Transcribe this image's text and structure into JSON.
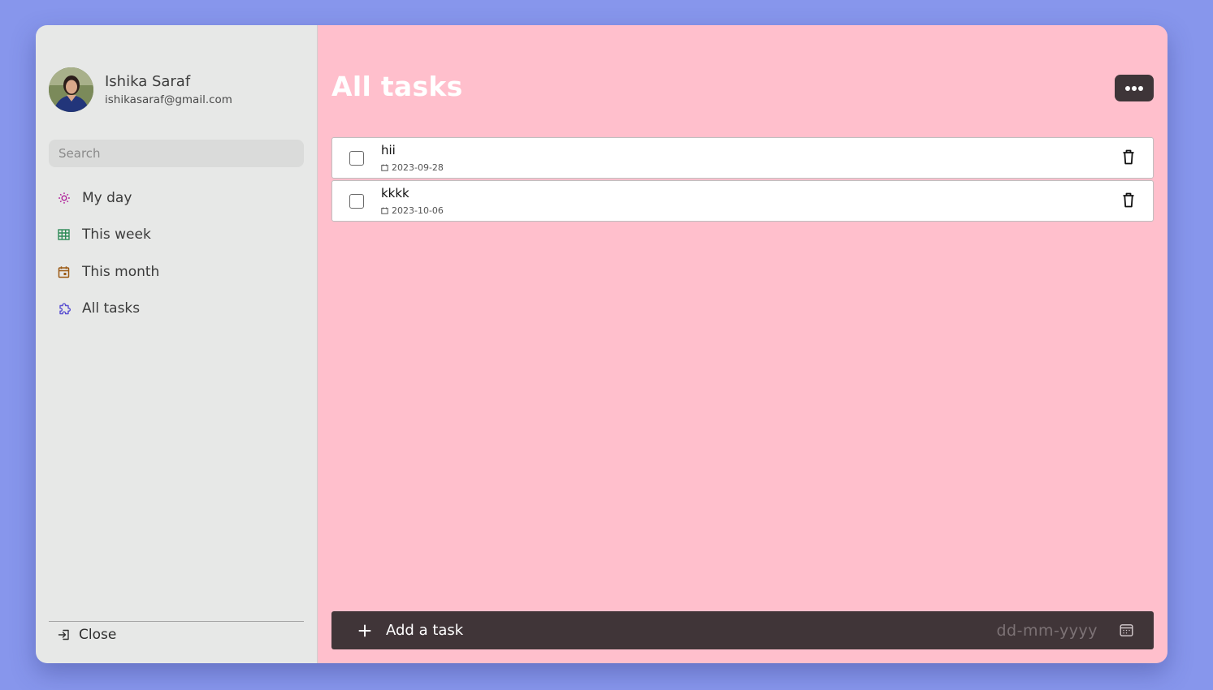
{
  "user": {
    "name": "Ishika Saraf",
    "email": "ishikasaraf@gmail.com"
  },
  "search": {
    "placeholder": "Search"
  },
  "nav": [
    {
      "label": "My day",
      "icon": "sun-icon",
      "color": "#b0219a"
    },
    {
      "label": "This week",
      "icon": "grid-icon",
      "color": "#2e8b57"
    },
    {
      "label": "This month",
      "icon": "calendar-icon",
      "color": "#9c5a14"
    },
    {
      "label": "All tasks",
      "icon": "puzzle-icon",
      "color": "#5a4fd1"
    }
  ],
  "sidebar_footer": {
    "close_label": "Close"
  },
  "main": {
    "title": "All tasks",
    "more_icon": "more-dots-icon"
  },
  "tasks": [
    {
      "title": "hii",
      "date": "2023-09-28",
      "completed": false
    },
    {
      "title": "kkkk",
      "date": "2023-10-06",
      "completed": false
    }
  ],
  "add_task": {
    "placeholder": "Add a task",
    "date_placeholder": "dd-mm-yyyy"
  },
  "colors": {
    "background": "#8796ec",
    "sidebar": "#e7e8e7",
    "main": "#ffbfcc",
    "dark": "#403538"
  }
}
